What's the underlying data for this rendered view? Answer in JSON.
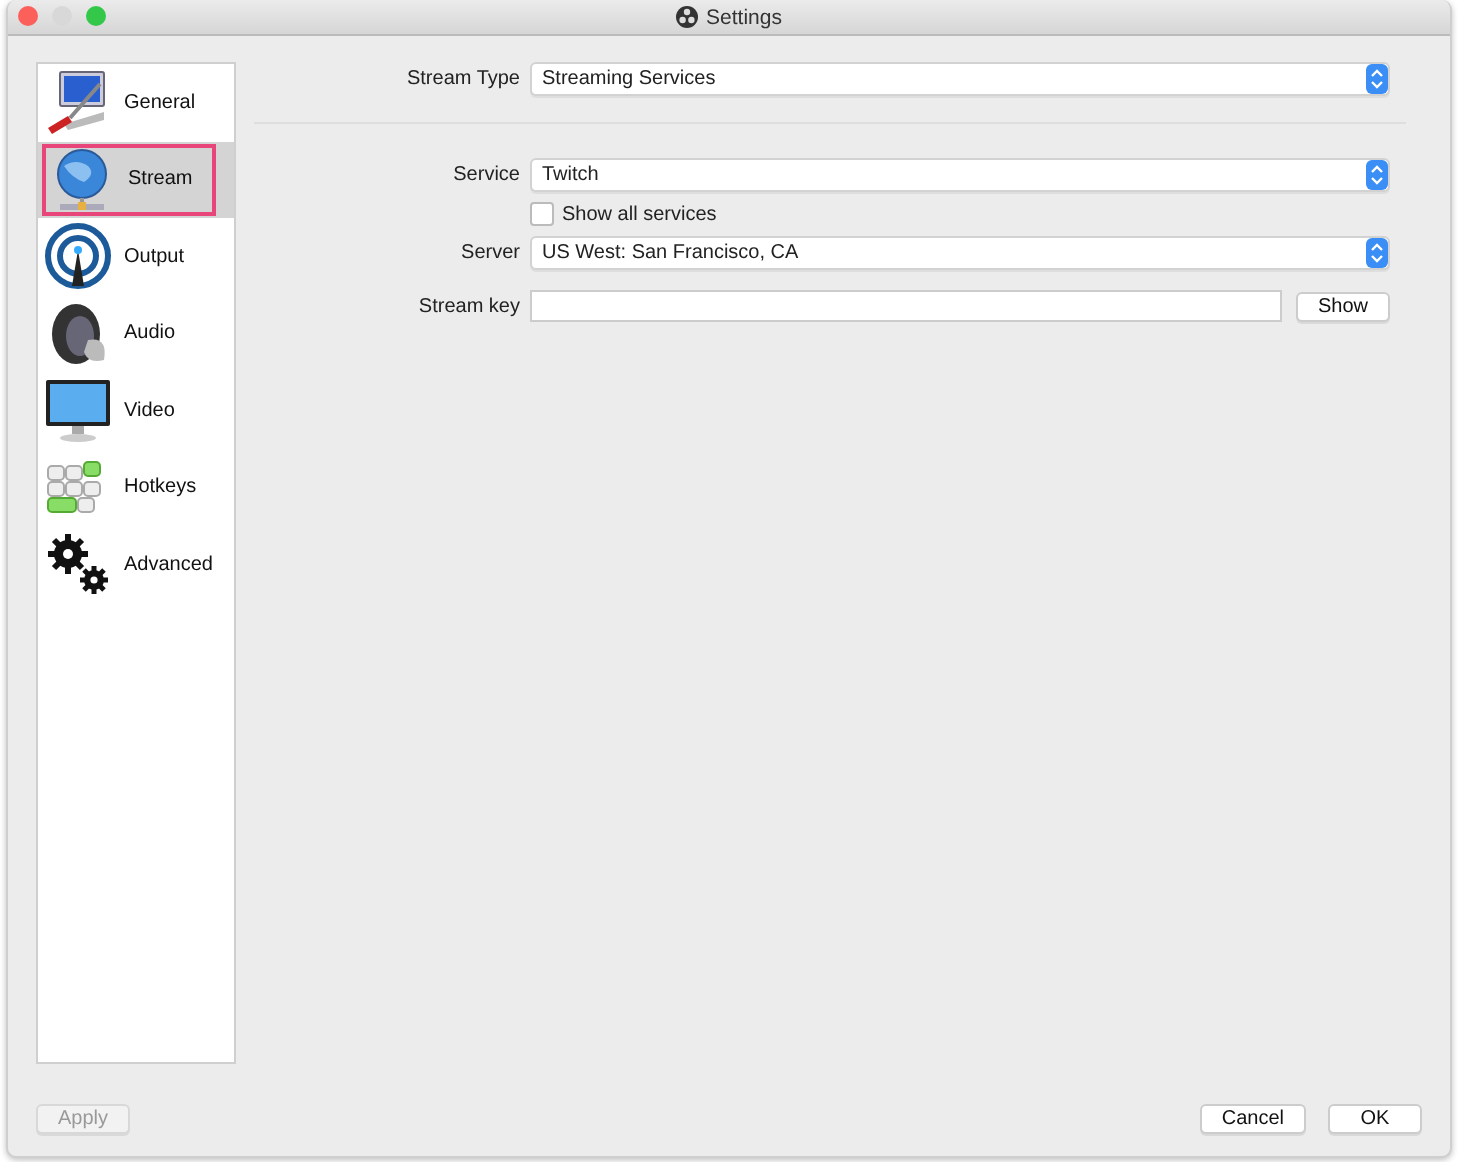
{
  "window": {
    "title": "Settings"
  },
  "sidebar": {
    "items": [
      {
        "label": "General",
        "kind": "general",
        "selected": false
      },
      {
        "label": "Stream",
        "kind": "stream",
        "selected": true
      },
      {
        "label": "Output",
        "kind": "output",
        "selected": false
      },
      {
        "label": "Audio",
        "kind": "audio",
        "selected": false
      },
      {
        "label": "Video",
        "kind": "video",
        "selected": false
      },
      {
        "label": "Hotkeys",
        "kind": "hotkeys",
        "selected": false
      },
      {
        "label": "Advanced",
        "kind": "advanced",
        "selected": false
      }
    ]
  },
  "stream_type": {
    "label": "Stream Type",
    "value": "Streaming Services"
  },
  "service": {
    "label": "Service",
    "value": "Twitch"
  },
  "show_all_services": {
    "label": "Show all services",
    "checked": false
  },
  "server": {
    "label": "Server",
    "value": "US West: San Francisco, CA"
  },
  "stream_key": {
    "label": "Stream key",
    "button": "Show"
  },
  "buttons": {
    "apply": {
      "label": "Apply",
      "disabled": true
    },
    "cancel": "Cancel",
    "ok": "OK"
  }
}
